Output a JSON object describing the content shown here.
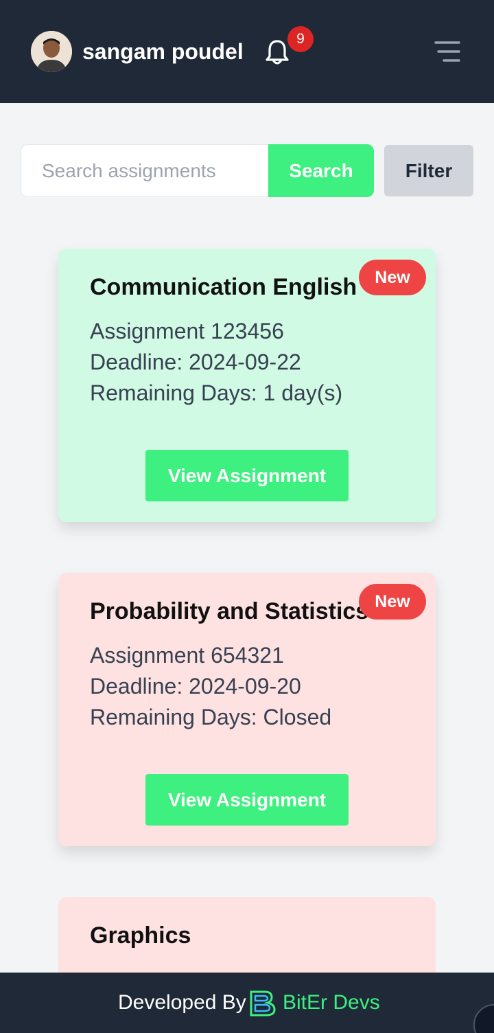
{
  "header": {
    "user_name": "sangam poudel",
    "notification_count": "9"
  },
  "search": {
    "placeholder": "Search assignments",
    "search_label": "Search",
    "filter_label": "Filter"
  },
  "cards": [
    {
      "title": "Communication English",
      "badge": "New",
      "assignment": "Assignment 123456",
      "deadline": "Deadline: 2024-09-22",
      "remaining": "Remaining Days: 1 day(s)",
      "button": "View Assignment",
      "status_color": "#d1fae5"
    },
    {
      "title": "Probability and Statistics",
      "badge": "New",
      "assignment": "Assignment 654321",
      "deadline": "Deadline: 2024-09-20",
      "remaining": "Remaining Days: Closed",
      "button": "View Assignment",
      "status_color": "#fee2e2"
    },
    {
      "title": "Graphics",
      "status_color": "#fee2e2"
    }
  ],
  "footer": {
    "developed_by": "Developed By",
    "brand": "BitEr Devs"
  },
  "colors": {
    "accent": "#3ef07f",
    "header_bg": "#1f2937",
    "badge_red": "#ef4444"
  }
}
